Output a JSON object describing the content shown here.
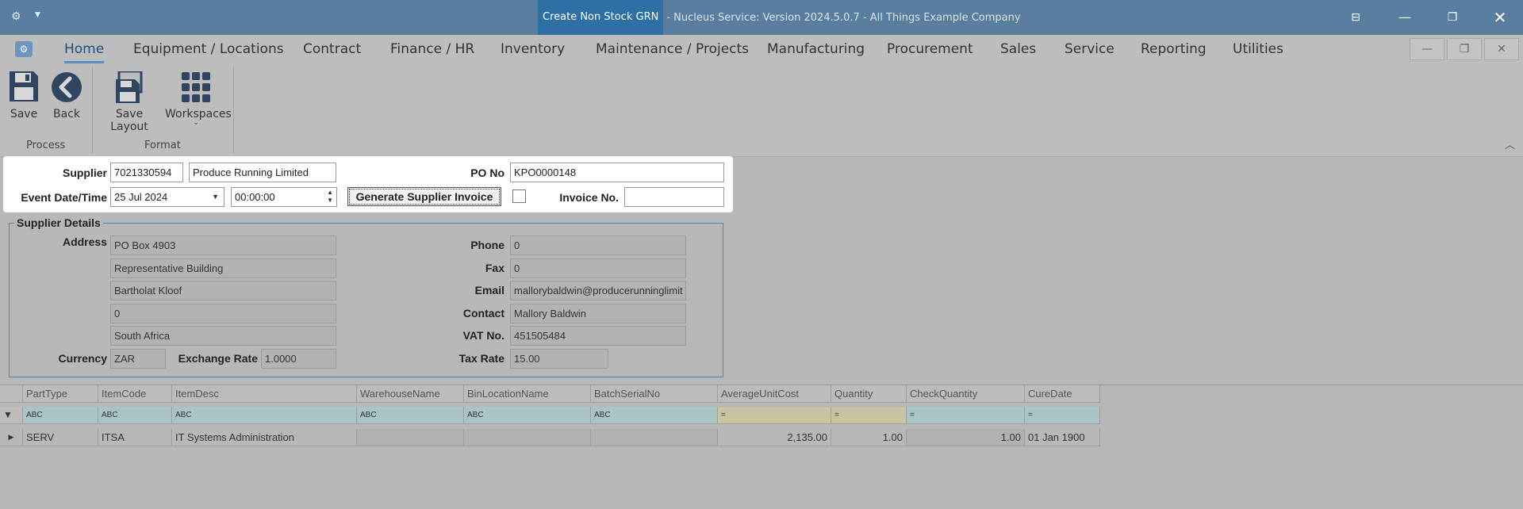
{
  "window": {
    "title_highlight": "Create Non Stock GRN",
    "title_rest": "- Nucleus Service: Version 2024.5.0.7 - All Things Example Company"
  },
  "tabs": [
    "Home",
    "Equipment / Locations",
    "Contract",
    "Finance / HR",
    "Inventory",
    "Maintenance / Projects",
    "Manufacturing",
    "Procurement",
    "Sales",
    "Service",
    "Reporting",
    "Utilities"
  ],
  "ribbon": {
    "save": "Save",
    "back": "Back",
    "process_group": "Process",
    "save_layout": "Save Layout",
    "workspaces": "Workspaces",
    "format_group": "Format"
  },
  "form": {
    "supplier_label": "Supplier",
    "supplier_code": "7021330594",
    "supplier_name": "Produce Running Limited",
    "po_label": "PO No",
    "po_no": "KPO0000148",
    "event_label": "Event Date/Time",
    "event_date": "25 Jul 2024",
    "event_time": "00:00:00",
    "generate_button": "Generate Supplier Invoice",
    "invoice_label": "Invoice No.",
    "invoice_no": ""
  },
  "supplier_details": {
    "title": "Supplier Details",
    "address_label": "Address",
    "address_lines": [
      "PO Box 4903",
      "Representative Building",
      "Bartholat Kloof",
      "0",
      "South Africa"
    ],
    "currency_label": "Currency",
    "currency": "ZAR",
    "exchange_label": "Exchange Rate",
    "exchange_rate": "1.0000",
    "phone_label": "Phone",
    "phone": "0",
    "fax_label": "Fax",
    "fax": "0",
    "email_label": "Email",
    "email": "mallorybaldwin@producerunninglimit",
    "contact_label": "Contact",
    "contact": "Mallory Baldwin",
    "vat_label": "VAT No.",
    "vat": "451505484",
    "tax_label": "Tax Rate",
    "tax_rate": "15.00"
  },
  "grid": {
    "columns": [
      "PartType",
      "ItemCode",
      "ItemDesc",
      "WarehouseName",
      "BinLocationName",
      "BatchSerialNo",
      "AverageUnitCost",
      "Quantity",
      "CheckQuantity",
      "CureDate"
    ],
    "filter_text_symbol": "ABC",
    "filter_num_symbol": "=",
    "rows": [
      [
        "SERV",
        "ITSA",
        "IT Systems Administration",
        "",
        "",
        "",
        "2,135.00",
        "1.00",
        "1.00",
        "01 Jan 1900"
      ]
    ]
  }
}
